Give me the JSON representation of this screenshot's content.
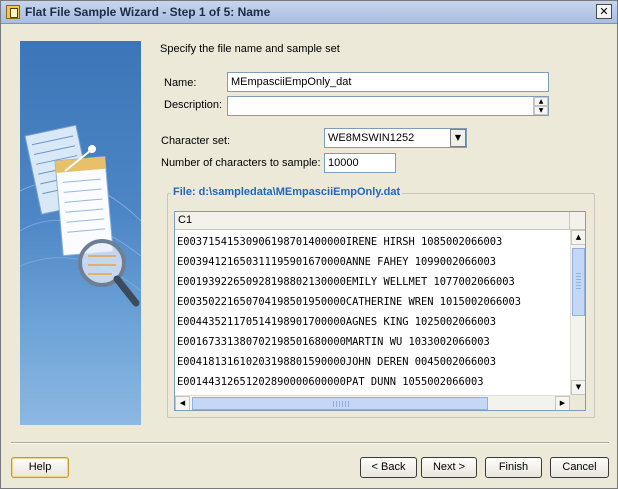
{
  "window": {
    "title": "Flat File Sample Wizard - Step 1 of 5: Name"
  },
  "instruction": "Specify the file name and sample set",
  "form": {
    "name_label": "Name:",
    "name_value": "MEmpasciiEmpOnly_dat",
    "description_label": "Description:",
    "description_value": "",
    "charset_label": "Character set:",
    "charset_value": "WE8MSWIN1252",
    "sample_label": "Number of characters to sample:",
    "sample_value": "10000"
  },
  "file_group": {
    "title": "File: d:\\sampledata\\MEmpasciiEmpOnly.dat",
    "column_header": "C1",
    "rows": [
      "E00371541530906198701400000IRENE HIRSH    1085002066003",
      "E00394121650311195901670000ANNE FAHEY     1099002066003",
      "E00193922650928198802130000EMILY WELLMET  1077002066003",
      "E00350221650704198501950000CATHERINE WREN 1015002066003",
      "E00443521170514198901700000AGNES KING     1025002066003",
      "E00167331380702198501680000MARTIN WU      1033002066003",
      "E00418131610203198801590000JOHN DEREN     0045002066003",
      "E00144312651202890000600000PAT DUNN       1055002066003"
    ],
    "vertical_scroll_position": 0,
    "horizontal_scroll_position": 0
  },
  "buttons": {
    "help": "Help",
    "back": "< Back",
    "next": "Next >",
    "finish": "Finish",
    "cancel": "Cancel"
  },
  "icons": {
    "title": "wizard-app-icon",
    "close": "close-icon",
    "spin_up": "spin-up-icon",
    "spin_down": "spin-down-icon",
    "combo": "chevron-down-icon"
  }
}
